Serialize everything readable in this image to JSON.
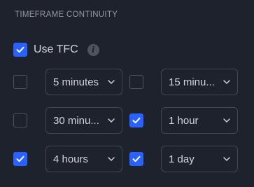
{
  "section": {
    "title": "TIMEFRAME CONTINUITY"
  },
  "use_tfc": {
    "label": "Use TFC",
    "checked": true,
    "info_icon": "info-icon"
  },
  "timeframes": [
    {
      "checked": false,
      "value": "5 minutes"
    },
    {
      "checked": false,
      "value": "15 minu..."
    },
    {
      "checked": false,
      "value": "30 minu..."
    },
    {
      "checked": true,
      "value": "1 hour"
    },
    {
      "checked": true,
      "value": "4 hours"
    },
    {
      "checked": true,
      "value": "1 day"
    }
  ],
  "colors": {
    "accent": "#2962ff",
    "background": "#1e222d",
    "text": "#d1d4dc",
    "muted": "#9598a1"
  }
}
